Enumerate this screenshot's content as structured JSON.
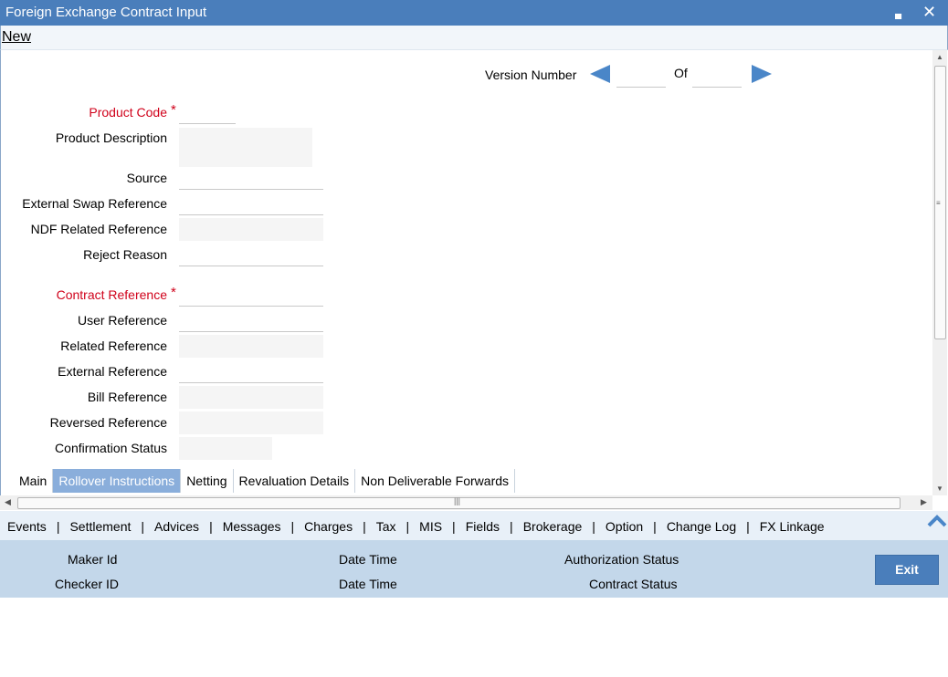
{
  "window": {
    "title": "Foreign Exchange Contract Input",
    "minimize_glyph": "▄",
    "close_glyph": "✕"
  },
  "menu": {
    "new_label": "New"
  },
  "version": {
    "label": "Version Number",
    "of_label": "Of",
    "current": "",
    "total": ""
  },
  "form": {
    "product_code": {
      "label": "Product Code",
      "required": "*",
      "value": ""
    },
    "product_description": {
      "label": "Product Description",
      "value": ""
    },
    "source": {
      "label": "Source",
      "value": ""
    },
    "external_swap_reference": {
      "label": "External Swap Reference",
      "value": ""
    },
    "ndf_related_reference": {
      "label": "NDF Related Reference",
      "value": ""
    },
    "reject_reason": {
      "label": "Reject Reason",
      "value": ""
    },
    "contract_reference": {
      "label": "Contract Reference",
      "required": "*",
      "value": ""
    },
    "user_reference": {
      "label": "User Reference",
      "value": ""
    },
    "related_reference": {
      "label": "Related Reference",
      "value": ""
    },
    "external_reference": {
      "label": "External Reference",
      "value": ""
    },
    "bill_reference": {
      "label": "Bill Reference",
      "value": ""
    },
    "reversed_reference": {
      "label": "Reversed Reference",
      "value": ""
    },
    "confirmation_status": {
      "label": "Confirmation Status",
      "value": ""
    }
  },
  "tabs": [
    "Main",
    "Rollover Instructions",
    "Netting",
    "Revaluation Details",
    "Non Deliverable Forwards"
  ],
  "active_tab": "Rollover Instructions",
  "scrollbars": {
    "vertical_grip": "≡",
    "horizontal_grip": "|||"
  },
  "links": [
    "Events",
    "Settlement",
    "Advices",
    "Messages",
    "Charges",
    "Tax",
    "MIS",
    "Fields",
    "Brokerage",
    "Option",
    "Change Log",
    "FX Linkage"
  ],
  "link_separator": "|",
  "footer": {
    "maker_id": "Maker Id",
    "checker_id": "Checker ID",
    "date_time_1": "Date Time",
    "date_time_2": "Date Time",
    "authorization_status": "Authorization Status",
    "contract_status": "Contract Status",
    "exit_label": "Exit"
  },
  "colors": {
    "titlebar": "#4a7ebb",
    "required": "#d0021b",
    "active_tab": "#8aaedb",
    "footer": "#c3d7ea",
    "arrow": "#4a86c8"
  }
}
